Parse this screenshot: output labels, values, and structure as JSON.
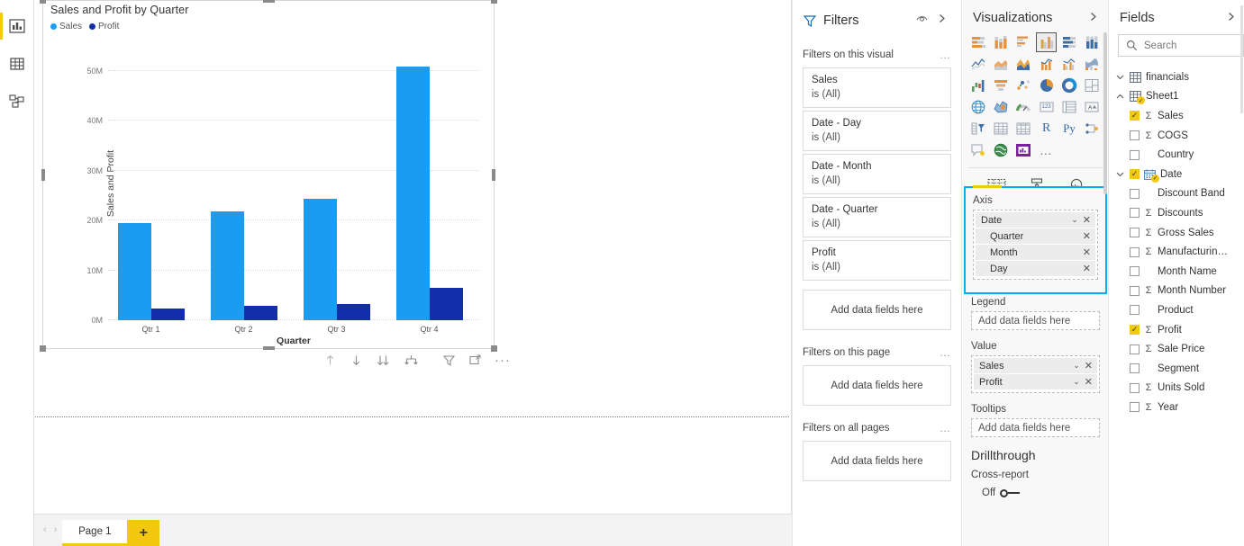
{
  "rail": {
    "items": [
      {
        "name": "report-view",
        "icon": "bar-chart-icon",
        "selected": true
      },
      {
        "name": "data-view",
        "icon": "table-icon",
        "selected": false
      },
      {
        "name": "model-view",
        "icon": "model-relationships-icon",
        "selected": false
      }
    ]
  },
  "visual": {
    "title": "Sales and Profit by Quarter",
    "legend": [
      {
        "label": "Sales",
        "color": "#1c9cf0"
      },
      {
        "label": "Profit",
        "color": "#122ea8"
      }
    ],
    "footer_icons": [
      "drill-up-icon",
      "drill-down-icon",
      "go-to-next-level-icon",
      "expand-all-down-icon",
      "filter-icon",
      "focus-mode-icon",
      "more-options-icon"
    ]
  },
  "chart_data": {
    "type": "bar",
    "title": "Sales and Profit by Quarter",
    "xlabel": "Quarter",
    "ylabel": "Sales and Profit",
    "categories": [
      "Qtr 1",
      "Qtr 2",
      "Qtr 3",
      "Qtr 4"
    ],
    "series": [
      {
        "name": "Sales",
        "color": "#1c9cf0",
        "values": [
          19.5,
          21.8,
          24.3,
          50.8
        ]
      },
      {
        "name": "Profit",
        "color": "#122ea8",
        "values": [
          2.3,
          2.8,
          3.2,
          6.5
        ]
      }
    ],
    "ylim": [
      0,
      55
    ],
    "ytick_labels": [
      "0M",
      "10M",
      "20M",
      "30M",
      "40M",
      "50M"
    ],
    "ytick_values": [
      0,
      10,
      20,
      30,
      40,
      50
    ],
    "units": "M",
    "grid": true,
    "legend_position": "top-left"
  },
  "pagebar": {
    "prev": "‹",
    "next": "›",
    "tab": "Page 1",
    "add": "+"
  },
  "filters": {
    "title": "Filters",
    "sections": [
      {
        "label": "Filters on this visual",
        "menu": "…",
        "cards": [
          {
            "field": "Sales",
            "value": "is (All)"
          },
          {
            "field": "Date - Day",
            "value": "is (All)"
          },
          {
            "field": "Date - Month",
            "value": "is (All)"
          },
          {
            "field": "Date - Quarter",
            "value": "is (All)"
          },
          {
            "field": "Profit",
            "value": "is (All)"
          }
        ],
        "dropzone": "Add data fields here"
      },
      {
        "label": "Filters on this page",
        "menu": "…",
        "cards": [],
        "dropzone": "Add data fields here"
      },
      {
        "label": "Filters on all pages",
        "menu": "…",
        "cards": [],
        "dropzone": "Add data fields here"
      }
    ]
  },
  "visualizations": {
    "title": "Visualizations",
    "icons": [
      {
        "name": "stacked-bar-chart-icon",
        "selected": false
      },
      {
        "name": "stacked-column-chart-icon",
        "selected": false
      },
      {
        "name": "clustered-bar-chart-icon",
        "selected": false
      },
      {
        "name": "clustered-column-chart-icon",
        "selected": true
      },
      {
        "name": "hundred-percent-stacked-bar-chart-icon",
        "selected": false
      },
      {
        "name": "hundred-percent-stacked-column-chart-icon",
        "selected": false
      },
      {
        "name": "line-chart-icon",
        "selected": false
      },
      {
        "name": "area-chart-icon",
        "selected": false
      },
      {
        "name": "stacked-area-chart-icon",
        "selected": false
      },
      {
        "name": "line-and-stacked-column-chart-icon",
        "selected": false
      },
      {
        "name": "line-and-clustered-column-chart-icon",
        "selected": false
      },
      {
        "name": "ribbon-chart-icon",
        "selected": false
      },
      {
        "name": "waterfall-chart-icon",
        "selected": false
      },
      {
        "name": "funnel-chart-icon",
        "selected": false
      },
      {
        "name": "scatter-chart-icon",
        "selected": false
      },
      {
        "name": "pie-chart-icon",
        "selected": false
      },
      {
        "name": "donut-chart-icon",
        "selected": false
      },
      {
        "name": "treemap-icon",
        "selected": false
      },
      {
        "name": "map-icon",
        "selected": false
      },
      {
        "name": "filled-map-icon",
        "selected": false
      },
      {
        "name": "gauge-icon",
        "selected": false
      },
      {
        "name": "card-icon",
        "selected": false
      },
      {
        "name": "multi-row-card-icon",
        "selected": false
      },
      {
        "name": "kpi-icon",
        "selected": false
      },
      {
        "name": "slicer-icon",
        "selected": false
      },
      {
        "name": "table-icon",
        "selected": false
      },
      {
        "name": "matrix-icon",
        "selected": false
      },
      {
        "name": "r-script-visual-icon",
        "selected": false
      },
      {
        "name": "python-visual-icon",
        "selected": false
      },
      {
        "name": "key-influencers-icon",
        "selected": false
      },
      {
        "name": "qna-visual-icon",
        "selected": false
      },
      {
        "name": "arcgis-maps-icon",
        "selected": false
      },
      {
        "name": "paginated-report-icon",
        "selected": true
      },
      {
        "name": "more-visuals-icon",
        "selected": false
      }
    ],
    "icon_labels": {
      "r_label": "R",
      "py_label": "Py",
      "num_label": "123",
      "more_label": "…"
    },
    "subbar": [
      {
        "name": "fields-pane-icon"
      },
      {
        "name": "format-pane-icon"
      },
      {
        "name": "analytics-pane-icon"
      }
    ],
    "wells": [
      {
        "label": "Axis",
        "highlighted": true,
        "chips": [
          {
            "name": "Date",
            "child": false,
            "has_dropdown": true,
            "has_close": true
          },
          {
            "name": "Quarter",
            "child": true,
            "has_dropdown": false,
            "has_close": true
          },
          {
            "name": "Month",
            "child": true,
            "has_dropdown": false,
            "has_close": true
          },
          {
            "name": "Day",
            "child": true,
            "has_dropdown": false,
            "has_close": true
          }
        ],
        "dropzone": null
      },
      {
        "label": "Legend",
        "highlighted": false,
        "chips": [],
        "dropzone": "Add data fields here"
      },
      {
        "label": "Value",
        "highlighted": false,
        "chips": [
          {
            "name": "Sales",
            "child": false,
            "has_dropdown": true,
            "has_close": true
          },
          {
            "name": "Profit",
            "child": false,
            "has_dropdown": true,
            "has_close": true
          }
        ],
        "dropzone": null
      },
      {
        "label": "Tooltips",
        "highlighted": false,
        "chips": [],
        "dropzone": "Add data fields here"
      }
    ],
    "drillthrough": {
      "title": "Drillthrough",
      "cross_report_label": "Cross-report",
      "toggle_state": "Off"
    },
    "chip_icons": {
      "dropdown": "⌄",
      "close": "✕"
    }
  },
  "fields": {
    "title": "Fields",
    "search_placeholder": "Search",
    "tables": [
      {
        "name": "financials",
        "expanded": false,
        "checked": false,
        "indent": 0,
        "kind": "table"
      },
      {
        "name": "Sheet1",
        "expanded": true,
        "checked": true,
        "indent": 0,
        "kind": "table"
      }
    ],
    "items": [
      {
        "label": "Sales",
        "checked": true,
        "measure": true,
        "kind": "field",
        "expandable": false
      },
      {
        "label": "COGS",
        "checked": false,
        "measure": true,
        "kind": "field",
        "expandable": false
      },
      {
        "label": "Country",
        "checked": false,
        "measure": false,
        "kind": "field",
        "expandable": false
      },
      {
        "label": "Date",
        "checked": true,
        "measure": false,
        "kind": "date-hierarchy",
        "expandable": true
      },
      {
        "label": "Discount Band",
        "checked": false,
        "measure": false,
        "kind": "field",
        "expandable": false
      },
      {
        "label": "Discounts",
        "checked": false,
        "measure": true,
        "kind": "field",
        "expandable": false
      },
      {
        "label": "Gross Sales",
        "checked": false,
        "measure": true,
        "kind": "field",
        "expandable": false
      },
      {
        "label": "Manufacturin…",
        "checked": false,
        "measure": true,
        "kind": "field",
        "expandable": false
      },
      {
        "label": "Month Name",
        "checked": false,
        "measure": false,
        "kind": "field",
        "expandable": false
      },
      {
        "label": "Month Number",
        "checked": false,
        "measure": true,
        "kind": "field",
        "expandable": false
      },
      {
        "label": "Product",
        "checked": false,
        "measure": false,
        "kind": "field",
        "expandable": false
      },
      {
        "label": "Profit",
        "checked": true,
        "measure": true,
        "kind": "field",
        "expandable": false
      },
      {
        "label": "Sale Price",
        "checked": false,
        "measure": true,
        "kind": "field",
        "expandable": false
      },
      {
        "label": "Segment",
        "checked": false,
        "measure": false,
        "kind": "field",
        "expandable": false
      },
      {
        "label": "Units Sold",
        "checked": false,
        "measure": true,
        "kind": "field",
        "expandable": false
      },
      {
        "label": "Year",
        "checked": false,
        "measure": true,
        "kind": "field",
        "expandable": false
      }
    ],
    "sigma": "Σ"
  },
  "colors": {
    "accent_yellow": "#f2c811",
    "highlight_blue": "#00b0f0",
    "sales_blue": "#1c9cf0",
    "profit_navy": "#122ea8"
  }
}
